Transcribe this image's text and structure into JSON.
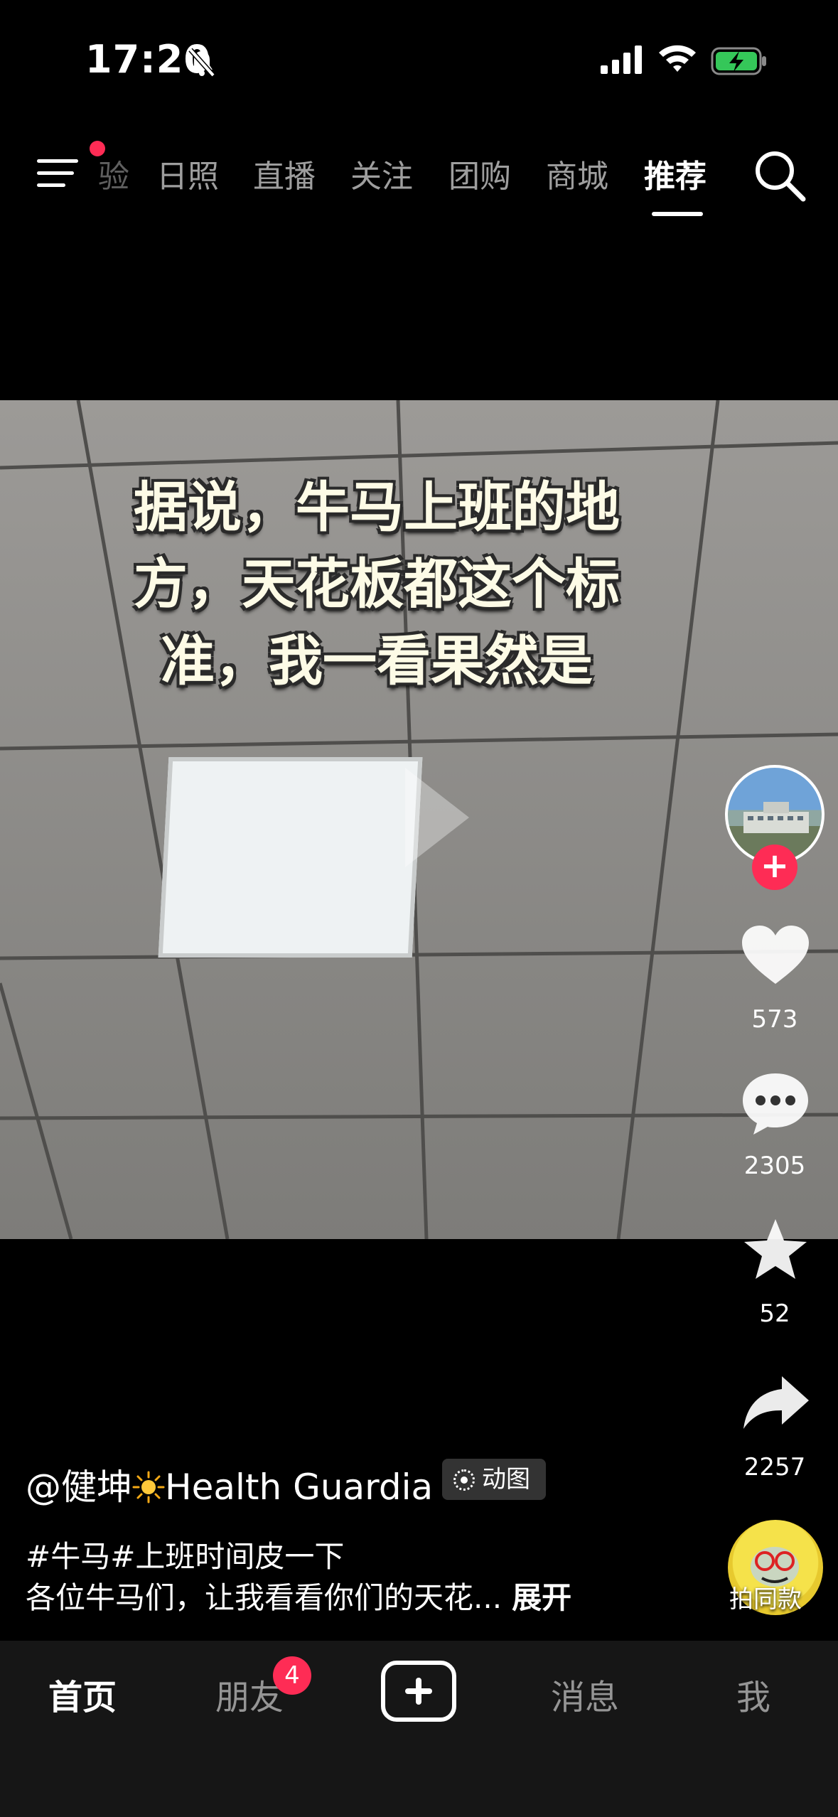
{
  "status_bar": {
    "time": "17:20"
  },
  "top_nav": {
    "tabs": [
      {
        "label": "验",
        "active": false
      },
      {
        "label": "日照",
        "active": false
      },
      {
        "label": "直播",
        "active": false
      },
      {
        "label": "关注",
        "active": false
      },
      {
        "label": "团购",
        "active": false
      },
      {
        "label": "商城",
        "active": false
      },
      {
        "label": "推荐",
        "active": true
      }
    ]
  },
  "video": {
    "caption_lines": [
      "据说，牛马上班的地",
      "方，天花板都这个标",
      "准，我一看果然是"
    ]
  },
  "actions": {
    "likes": "573",
    "comments": "2305",
    "favorites": "52",
    "shares": "2257"
  },
  "post": {
    "author": "@健坤",
    "author_suffix": "Health Guardia",
    "badge": "动图",
    "tags": "#牛马#上班时间皮一下",
    "description": "各位牛马们，让我看看你们的天花...",
    "more": "展开",
    "same_style": "拍同款"
  },
  "tab_bar": {
    "home": "首页",
    "friends": "朋友",
    "friends_badge": "4",
    "messages": "消息",
    "me": "我"
  },
  "colors": {
    "accent": "#fe2c55",
    "background": "#000000",
    "tabbar": "#161616"
  }
}
